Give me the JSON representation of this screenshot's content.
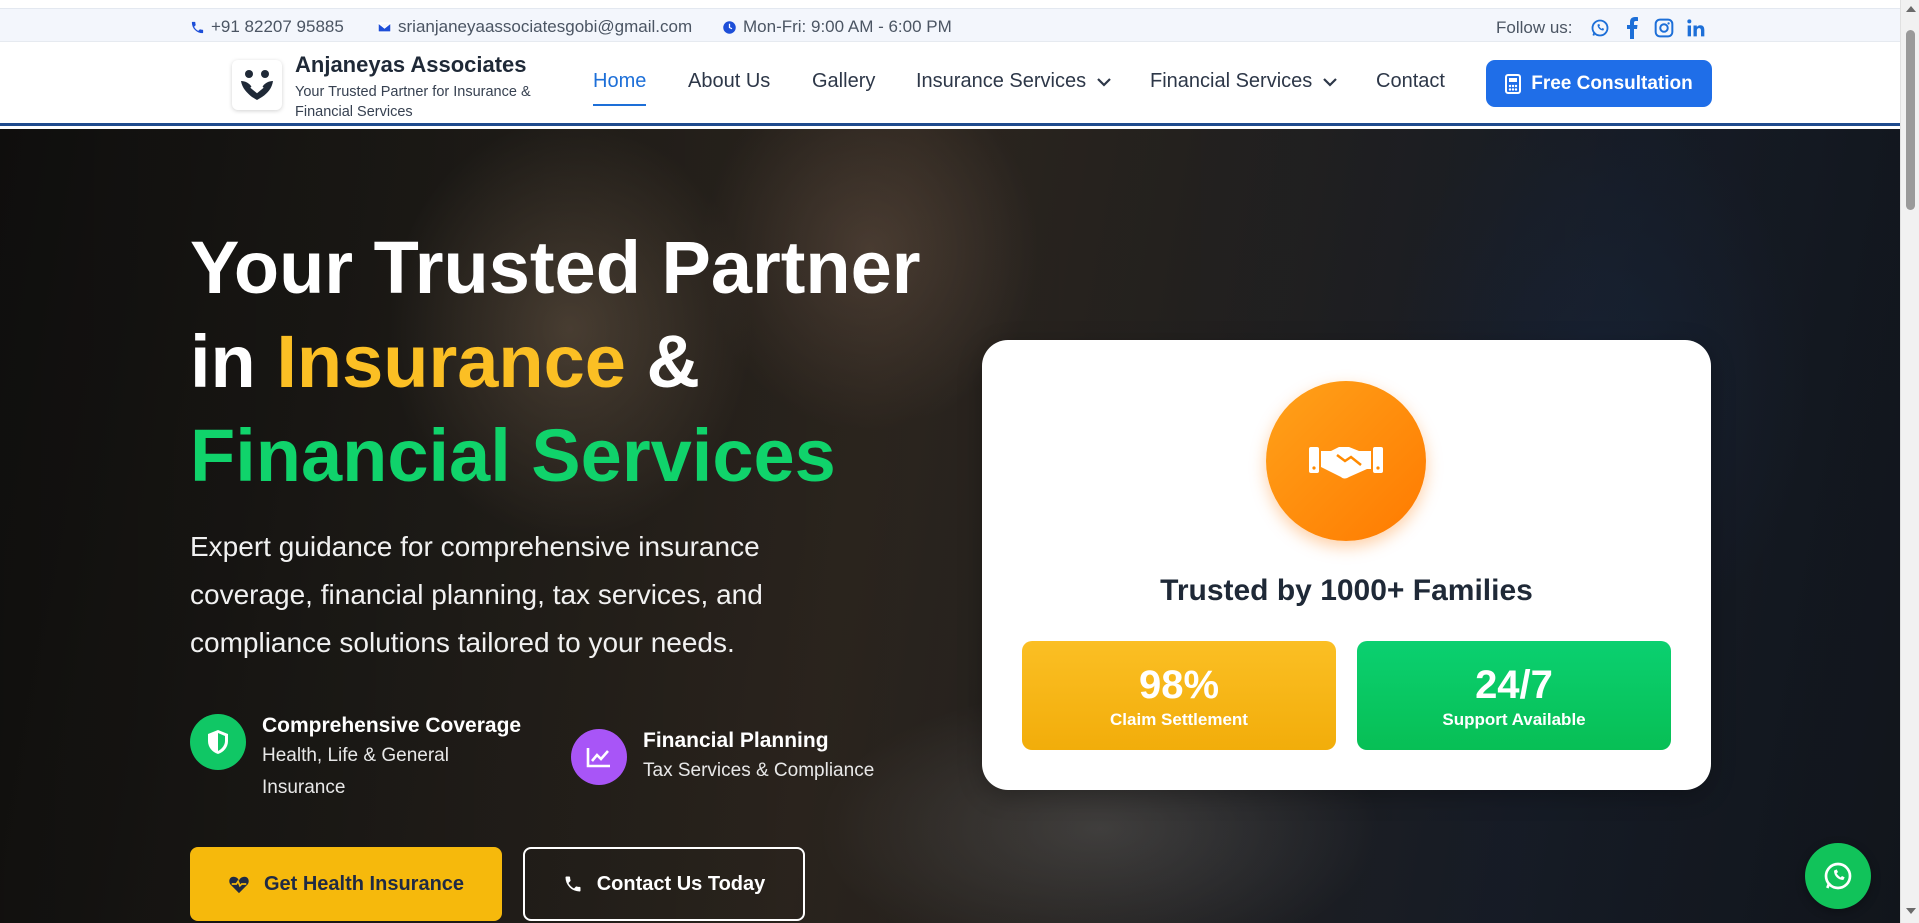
{
  "topbar": {
    "phone": "+91 82207 95885",
    "email": "srianjaneyaassociatesgobi@gmail.com",
    "hours": "Mon-Fri: 9:00 AM - 6:00 PM",
    "follow_label": "Follow us:",
    "socials": [
      "whatsapp-icon",
      "facebook-icon",
      "instagram-icon",
      "linkedin-icon"
    ]
  },
  "header": {
    "brand_name": "Anjaneyas Associates",
    "brand_tagline": "Your Trusted Partner for Insurance & Financial Services",
    "nav": {
      "home": "Home",
      "about": "About Us",
      "gallery": "Gallery",
      "insurance": "Insurance Services",
      "financial": "Financial Services",
      "contact": "Contact"
    },
    "cta_label": "Free Consultation"
  },
  "hero": {
    "headline_line1": "Your Trusted Partner",
    "headline_in": "in ",
    "headline_insurance": "Insurance",
    "headline_amp": " &",
    "headline_line3": "Financial Services",
    "subtext": "Expert guidance for comprehensive insurance coverage, financial planning, tax services, and compliance solutions tailored to your needs.",
    "feature1_title": "Comprehensive Coverage",
    "feature1_sub": "Health, Life & General Insurance",
    "feature2_title": "Financial Planning",
    "feature2_sub": "Tax Services & Compliance",
    "btn_primary": "Get Health Insurance",
    "btn_secondary": "Contact Us Today"
  },
  "card": {
    "title": "Trusted by 1000+ Families",
    "stat1_value": "98%",
    "stat1_label": "Claim Settlement",
    "stat2_value": "24/7",
    "stat2_label": "Support Available"
  },
  "colors": {
    "primary_blue": "#1f6ee8",
    "accent_yellow": "#fbbf24",
    "accent_green": "#10d36b",
    "orange": "#ff8a00",
    "purple": "#a855f7"
  }
}
